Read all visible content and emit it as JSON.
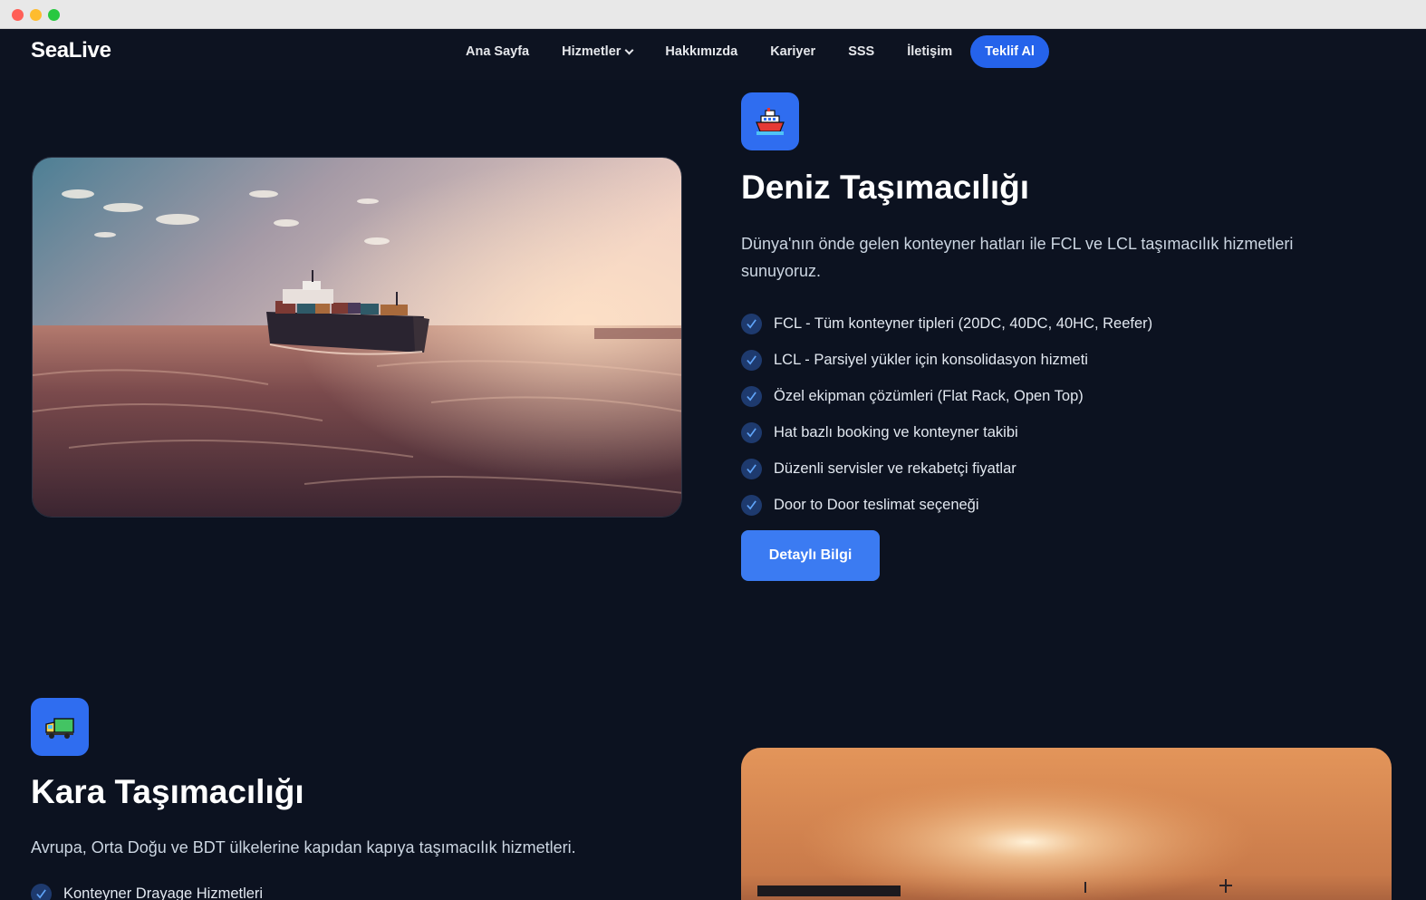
{
  "brand": "SeaLive",
  "nav": {
    "items": [
      "Ana Sayfa",
      "Hizmetler",
      "Hakkımızda",
      "Kariyer",
      "SSS",
      "İletişim"
    ],
    "cta": "Teklif Al"
  },
  "sections": [
    {
      "icon": "ship-icon",
      "title": "Deniz Taşımacılığı",
      "description": "Dünya'nın önde gelen konteyner hatları ile FCL ve LCL taşımacılık hizmetleri sunuyoruz.",
      "features": [
        "FCL - Tüm konteyner tipleri (20DC, 40DC, 40HC, Reefer)",
        "LCL - Parsiyel yükler için konsolidasyon hizmeti",
        "Özel ekipman çözümleri (Flat Rack, Open Top)",
        "Hat bazlı booking ve konteyner takibi",
        "Düzenli servisler ve rekabetçi fiyatlar",
        "Door to Door teslimat seçeneği"
      ],
      "button": "Detaylı Bilgi"
    },
    {
      "icon": "truck-icon",
      "title": "Kara Taşımacılığı",
      "description": "Avrupa, Orta Doğu ve BDT ülkelerine kapıdan kapıya taşımacılık hizmetleri.",
      "features": [
        "Konteyner Drayage Hizmetleri"
      ]
    }
  ],
  "colors": {
    "background": "#0c1220",
    "accent": "#2563eb",
    "check_bg": "#1e3a6e"
  }
}
